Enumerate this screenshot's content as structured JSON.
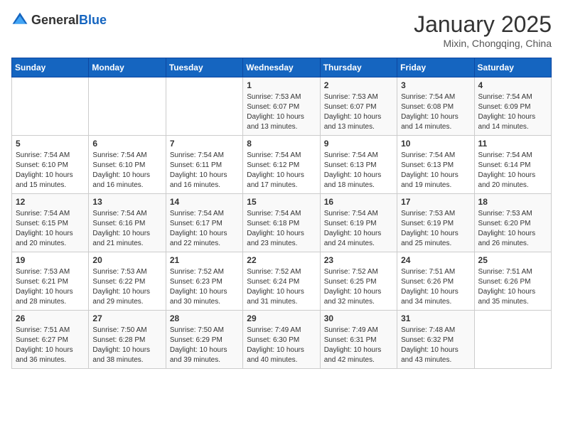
{
  "header": {
    "logo_general": "General",
    "logo_blue": "Blue",
    "month_title": "January 2025",
    "location": "Mixin, Chongqing, China"
  },
  "weekdays": [
    "Sunday",
    "Monday",
    "Tuesday",
    "Wednesday",
    "Thursday",
    "Friday",
    "Saturday"
  ],
  "weeks": [
    [
      {
        "day": "",
        "detail": ""
      },
      {
        "day": "",
        "detail": ""
      },
      {
        "day": "",
        "detail": ""
      },
      {
        "day": "1",
        "detail": "Sunrise: 7:53 AM\nSunset: 6:07 PM\nDaylight: 10 hours\nand 13 minutes."
      },
      {
        "day": "2",
        "detail": "Sunrise: 7:53 AM\nSunset: 6:07 PM\nDaylight: 10 hours\nand 13 minutes."
      },
      {
        "day": "3",
        "detail": "Sunrise: 7:54 AM\nSunset: 6:08 PM\nDaylight: 10 hours\nand 14 minutes."
      },
      {
        "day": "4",
        "detail": "Sunrise: 7:54 AM\nSunset: 6:09 PM\nDaylight: 10 hours\nand 14 minutes."
      }
    ],
    [
      {
        "day": "5",
        "detail": "Sunrise: 7:54 AM\nSunset: 6:10 PM\nDaylight: 10 hours\nand 15 minutes."
      },
      {
        "day": "6",
        "detail": "Sunrise: 7:54 AM\nSunset: 6:10 PM\nDaylight: 10 hours\nand 16 minutes."
      },
      {
        "day": "7",
        "detail": "Sunrise: 7:54 AM\nSunset: 6:11 PM\nDaylight: 10 hours\nand 16 minutes."
      },
      {
        "day": "8",
        "detail": "Sunrise: 7:54 AM\nSunset: 6:12 PM\nDaylight: 10 hours\nand 17 minutes."
      },
      {
        "day": "9",
        "detail": "Sunrise: 7:54 AM\nSunset: 6:13 PM\nDaylight: 10 hours\nand 18 minutes."
      },
      {
        "day": "10",
        "detail": "Sunrise: 7:54 AM\nSunset: 6:13 PM\nDaylight: 10 hours\nand 19 minutes."
      },
      {
        "day": "11",
        "detail": "Sunrise: 7:54 AM\nSunset: 6:14 PM\nDaylight: 10 hours\nand 20 minutes."
      }
    ],
    [
      {
        "day": "12",
        "detail": "Sunrise: 7:54 AM\nSunset: 6:15 PM\nDaylight: 10 hours\nand 20 minutes."
      },
      {
        "day": "13",
        "detail": "Sunrise: 7:54 AM\nSunset: 6:16 PM\nDaylight: 10 hours\nand 21 minutes."
      },
      {
        "day": "14",
        "detail": "Sunrise: 7:54 AM\nSunset: 6:17 PM\nDaylight: 10 hours\nand 22 minutes."
      },
      {
        "day": "15",
        "detail": "Sunrise: 7:54 AM\nSunset: 6:18 PM\nDaylight: 10 hours\nand 23 minutes."
      },
      {
        "day": "16",
        "detail": "Sunrise: 7:54 AM\nSunset: 6:19 PM\nDaylight: 10 hours\nand 24 minutes."
      },
      {
        "day": "17",
        "detail": "Sunrise: 7:53 AM\nSunset: 6:19 PM\nDaylight: 10 hours\nand 25 minutes."
      },
      {
        "day": "18",
        "detail": "Sunrise: 7:53 AM\nSunset: 6:20 PM\nDaylight: 10 hours\nand 26 minutes."
      }
    ],
    [
      {
        "day": "19",
        "detail": "Sunrise: 7:53 AM\nSunset: 6:21 PM\nDaylight: 10 hours\nand 28 minutes."
      },
      {
        "day": "20",
        "detail": "Sunrise: 7:53 AM\nSunset: 6:22 PM\nDaylight: 10 hours\nand 29 minutes."
      },
      {
        "day": "21",
        "detail": "Sunrise: 7:52 AM\nSunset: 6:23 PM\nDaylight: 10 hours\nand 30 minutes."
      },
      {
        "day": "22",
        "detail": "Sunrise: 7:52 AM\nSunset: 6:24 PM\nDaylight: 10 hours\nand 31 minutes."
      },
      {
        "day": "23",
        "detail": "Sunrise: 7:52 AM\nSunset: 6:25 PM\nDaylight: 10 hours\nand 32 minutes."
      },
      {
        "day": "24",
        "detail": "Sunrise: 7:51 AM\nSunset: 6:26 PM\nDaylight: 10 hours\nand 34 minutes."
      },
      {
        "day": "25",
        "detail": "Sunrise: 7:51 AM\nSunset: 6:26 PM\nDaylight: 10 hours\nand 35 minutes."
      }
    ],
    [
      {
        "day": "26",
        "detail": "Sunrise: 7:51 AM\nSunset: 6:27 PM\nDaylight: 10 hours\nand 36 minutes."
      },
      {
        "day": "27",
        "detail": "Sunrise: 7:50 AM\nSunset: 6:28 PM\nDaylight: 10 hours\nand 38 minutes."
      },
      {
        "day": "28",
        "detail": "Sunrise: 7:50 AM\nSunset: 6:29 PM\nDaylight: 10 hours\nand 39 minutes."
      },
      {
        "day": "29",
        "detail": "Sunrise: 7:49 AM\nSunset: 6:30 PM\nDaylight: 10 hours\nand 40 minutes."
      },
      {
        "day": "30",
        "detail": "Sunrise: 7:49 AM\nSunset: 6:31 PM\nDaylight: 10 hours\nand 42 minutes."
      },
      {
        "day": "31",
        "detail": "Sunrise: 7:48 AM\nSunset: 6:32 PM\nDaylight: 10 hours\nand 43 minutes."
      },
      {
        "day": "",
        "detail": ""
      }
    ]
  ]
}
